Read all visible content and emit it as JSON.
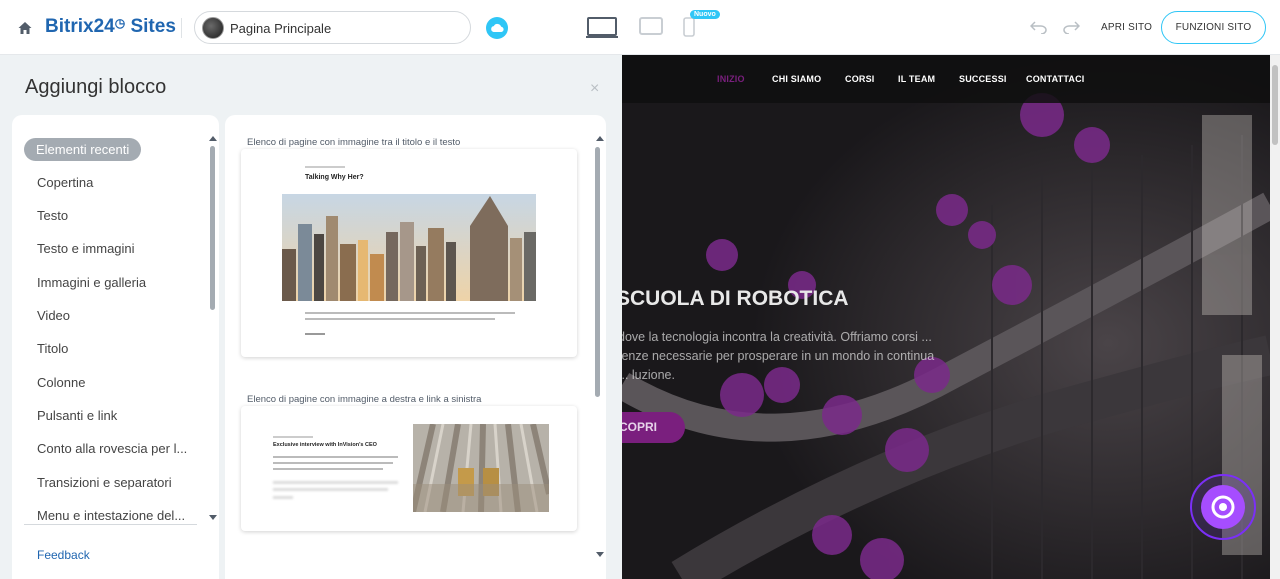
{
  "topbar": {
    "logo_b24": "Bitrix24",
    "logo_sites": "Sites",
    "page_name": "Pagina Principale",
    "new_badge": "Nuovo",
    "open_site": "APRI SITO",
    "site_features": "FUNZIONI SITO"
  },
  "panel": {
    "title": "Aggiungi blocco",
    "close": "×",
    "categories": [
      "Elementi recenti",
      "Copertina",
      "Testo",
      "Testo e immagini",
      "Immagini e galleria",
      "Video",
      "Titolo",
      "Colonne",
      "Pulsanti e link",
      "Conto alla rovescia per l...",
      "Transizioni e separatori",
      "Menu e intestazione del..."
    ],
    "feedback": "Feedback",
    "blocks": [
      {
        "title": "Elenco di pagine con immagine tra il titolo e il testo",
        "card_heading": "Talking Why Her?"
      },
      {
        "title": "Elenco di pagine con immagine a destra e link a sinistra",
        "card_heading": "Exclusive interview with InVision's CEO"
      }
    ]
  },
  "preview": {
    "nav": [
      "INIZIO",
      "CHI SIAMO",
      "CORSI",
      "IL TEAM",
      "SUCCESSI",
      "CONTATTACI"
    ],
    "hero_title": "SCUOLA DI ROBOTICA",
    "hero_text": "dove la tecnologia incontra la creatività. Offriamo corsi ... tenze necessarie per prosperare in un mondo in continua ... luzione.",
    "hero_button": "COPRI"
  },
  "colors": {
    "accent": "#2fc6f6",
    "brand_blue": "#2066b0",
    "preview_accent": "#7a1f7e"
  }
}
